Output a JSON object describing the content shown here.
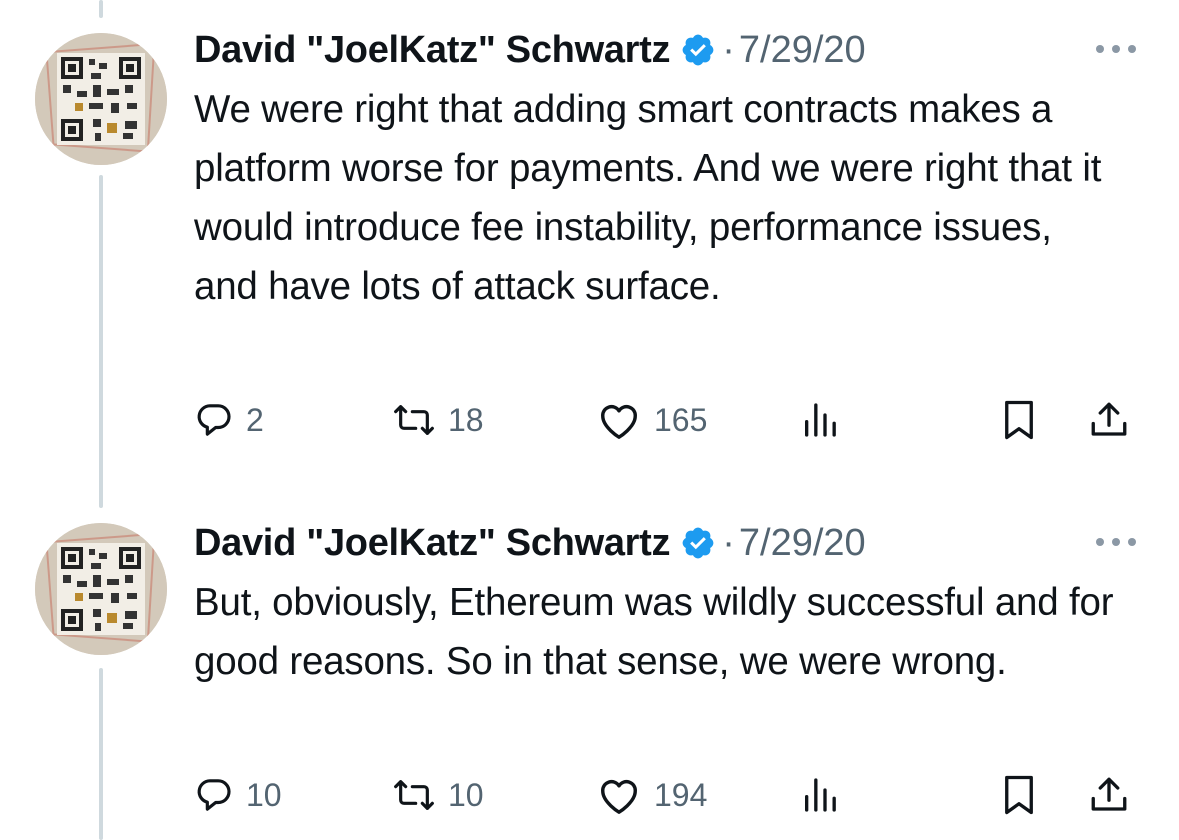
{
  "tweets": [
    {
      "author": "David \"JoelKatz\" Schwartz",
      "separator": "·",
      "date": "7/29/20",
      "text": "We were right that adding smart contracts makes a platform worse for payments. And we were right that it would introduce fee instability, performance issues, and have lots of attack surface.",
      "replies": "2",
      "retweets": "18",
      "likes": "165"
    },
    {
      "author": "David \"JoelKatz\" Schwartz",
      "separator": "·",
      "date": "7/29/20",
      "text": "But, obviously, Ethereum was wildly successful and for good reasons. So in that sense, we were wrong.",
      "replies": "10",
      "retweets": "10",
      "likes": "194"
    }
  ],
  "colors": {
    "text": "#0f1419",
    "secondary": "#536471",
    "verified": "#1d9bf0",
    "thread_line": "#cfd9de"
  },
  "icons": [
    "more-icon",
    "verified-badge-icon",
    "reply-icon",
    "retweet-icon",
    "like-icon",
    "views-icon",
    "bookmark-icon",
    "share-icon"
  ]
}
